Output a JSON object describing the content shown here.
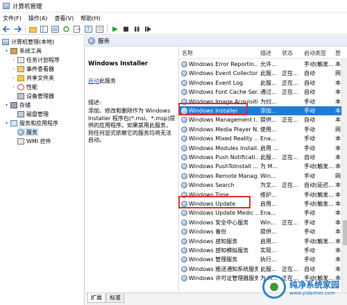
{
  "window": {
    "title": "计算机管理"
  },
  "menu": [
    "文件(F)",
    "操作(A)",
    "查看(V)",
    "帮助(H)"
  ],
  "toolbar_icons": [
    "back-arrow-icon",
    "forward-arrow-icon",
    "up-folder-icon",
    "show-tree-icon",
    "refresh-icon",
    "export-icon",
    "help-icon",
    "properties-icon",
    "play-icon",
    "stop-icon",
    "pause-icon",
    "restart-icon"
  ],
  "tree": {
    "root": "计算机管理(本地)",
    "system_tools": "系统工具",
    "task_scheduler": "任务计划程序",
    "event_viewer": "事件查看器",
    "shared_folders": "共享文件夹",
    "performance": "性能",
    "device_manager": "设备管理器",
    "storage": "存储",
    "disk_management": "磁盘管理",
    "services_apps": "服务和应用程序",
    "services": "服务",
    "wmi": "WMI 控件"
  },
  "header": {
    "title": "服务"
  },
  "description": {
    "service_name": "Windows Installer",
    "action_link": "启动",
    "action_suffix": "此服务",
    "label": "描述:",
    "text": "添加、修改和删除作为 Windows Installer 程序包(*.msi、*.msp)提供的应用程序。如果禁用此服务，则任何显式依赖它的服务均将无法启动。"
  },
  "columns": [
    "名称",
    "描述",
    "状态",
    "启动类型",
    "登"
  ],
  "services": [
    {
      "name": "Windows Error Reportin...",
      "desc": "允许...",
      "status": "",
      "startup": "手动(触发...",
      "logon": "本"
    },
    {
      "name": "Windows Event Collector",
      "desc": "此服...",
      "status": "正在...",
      "startup": "自动",
      "logon": "网"
    },
    {
      "name": "Windows Event Log",
      "desc": "此服...",
      "status": "正在...",
      "startup": "自动",
      "logon": "本"
    },
    {
      "name": "Windows Font Cache Ser...",
      "desc": "通过...",
      "status": "正在...",
      "startup": "自动",
      "logon": "本"
    },
    {
      "name": "Windows Image Acquisiti...",
      "desc": "为扫...",
      "status": "",
      "startup": "手动",
      "logon": "本"
    },
    {
      "name": "Windows Installer",
      "desc": "添加...",
      "status": "",
      "startup": "手动",
      "logon": "本"
    },
    {
      "name": "Windows Management I...",
      "desc": "提供...",
      "status": "正在...",
      "startup": "自动",
      "logon": "本"
    },
    {
      "name": "Windows Media Player N...",
      "desc": "使用...",
      "status": "",
      "startup": "手动",
      "logon": "网"
    },
    {
      "name": "Windows Mixed Reality ...",
      "desc": "Ena...",
      "status": "",
      "startup": "手动",
      "logon": "本"
    },
    {
      "name": "Windows Modules Install...",
      "desc": "启用 ...",
      "status": "",
      "startup": "手动",
      "logon": "本"
    },
    {
      "name": "Windows Push Notificati...",
      "desc": "此服...",
      "status": "正在...",
      "startup": "自动",
      "logon": "本"
    },
    {
      "name": "Windows PushToInstall ...",
      "desc": "为 M...",
      "status": "",
      "startup": "手动(触发...",
      "logon": "本"
    },
    {
      "name": "Windows Remote Manag...",
      "desc": "Win...",
      "status": "",
      "startup": "手动",
      "logon": "网"
    },
    {
      "name": "Windows Search",
      "desc": "为文...",
      "status": "正在...",
      "startup": "自动(延迟...",
      "logon": "本"
    },
    {
      "name": "Windows Time",
      "desc": "维护...",
      "status": "",
      "startup": "手动(触发...",
      "logon": "本"
    },
    {
      "name": "Windows Update",
      "desc": "启用...",
      "status": "",
      "startup": "手动(触发...",
      "logon": "本"
    },
    {
      "name": "Windows Update Medic ...",
      "desc": "Ena...",
      "status": "",
      "startup": "手动",
      "logon": "本"
    },
    {
      "name": "Windows 安全中心服务",
      "desc": "Win...",
      "status": "正在...",
      "startup": "手动",
      "logon": "本"
    },
    {
      "name": "Windows 备份",
      "desc": "提供...",
      "status": "",
      "startup": "手动",
      "logon": "本"
    },
    {
      "name": "Windows 感知服务",
      "desc": "启用...",
      "status": "",
      "startup": "手动(触发...",
      "logon": "本"
    },
    {
      "name": "Windows 感知模拟服务",
      "desc": "实现...",
      "status": "",
      "startup": "手动",
      "logon": "本"
    },
    {
      "name": "Windows 管理服务",
      "desc": "执行...",
      "status": "",
      "startup": "手动",
      "logon": "本"
    },
    {
      "name": "Windows 推送通知系统服务",
      "desc": "此服...",
      "status": "正在...",
      "startup": "自动",
      "logon": "本"
    },
    {
      "name": "Windows 许可证管理器服务",
      "desc": "为 M...",
      "status": "正在...",
      "startup": "手动(触发...",
      "logon": "本"
    }
  ],
  "bottom_tabs": [
    "扩展",
    "标准"
  ],
  "watermark": {
    "title": "纯净系统家园",
    "url": "www.yidaimei.com"
  },
  "colors": {
    "selection": "#1f7bd6",
    "highlight_box": "#e0282d",
    "link": "#2a5fa8"
  }
}
